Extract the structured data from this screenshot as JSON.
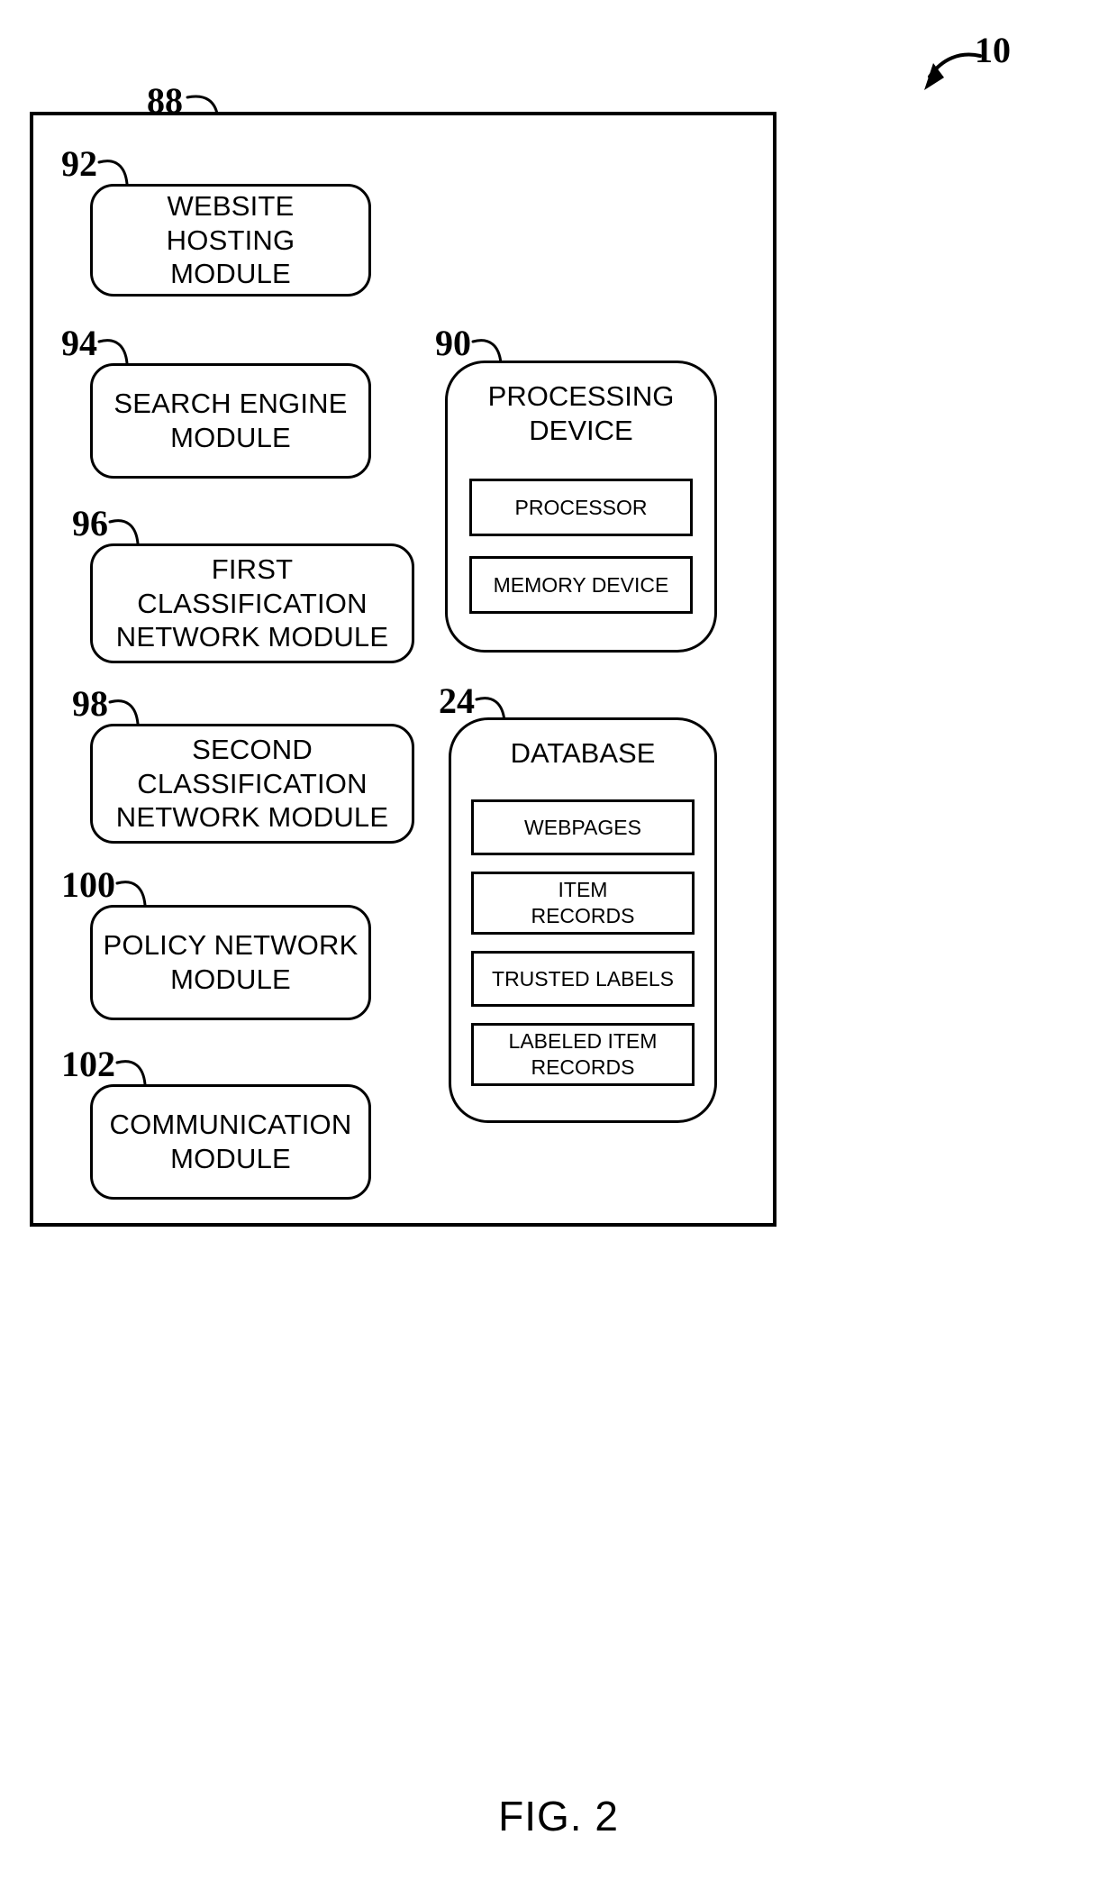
{
  "figure": {
    "caption": "FIG. 2",
    "system_ref": "10",
    "system_boundary_ref": "88"
  },
  "left_column": {
    "modules": [
      {
        "ref": "92",
        "label": "WEBSITE\nHOSTING\nMODULE"
      },
      {
        "ref": "94",
        "label": "SEARCH ENGINE\nMODULE"
      },
      {
        "ref": "96",
        "label": "FIRST\nCLASSIFICATION\nNETWORK MODULE"
      },
      {
        "ref": "98",
        "label": "SECOND\nCLASSIFICATION\nNETWORK MODULE"
      },
      {
        "ref": "100",
        "label": "POLICY NETWORK\nMODULE"
      },
      {
        "ref": "102",
        "label": "COMMUNICATION\nMODULE"
      }
    ]
  },
  "right_column": {
    "processing_device": {
      "ref": "90",
      "title": "PROCESSING\nDEVICE",
      "items": [
        {
          "label": "PROCESSOR"
        },
        {
          "label": "MEMORY DEVICE"
        }
      ]
    },
    "database": {
      "ref": "24",
      "title": "DATABASE",
      "items": [
        {
          "label": "WEBPAGES"
        },
        {
          "label": "ITEM\nRECORDS"
        },
        {
          "label": "TRUSTED LABELS"
        },
        {
          "label": "LABELED ITEM\nRECORDS"
        }
      ]
    }
  },
  "colors": {
    "stroke": "#000000",
    "background": "#ffffff"
  }
}
